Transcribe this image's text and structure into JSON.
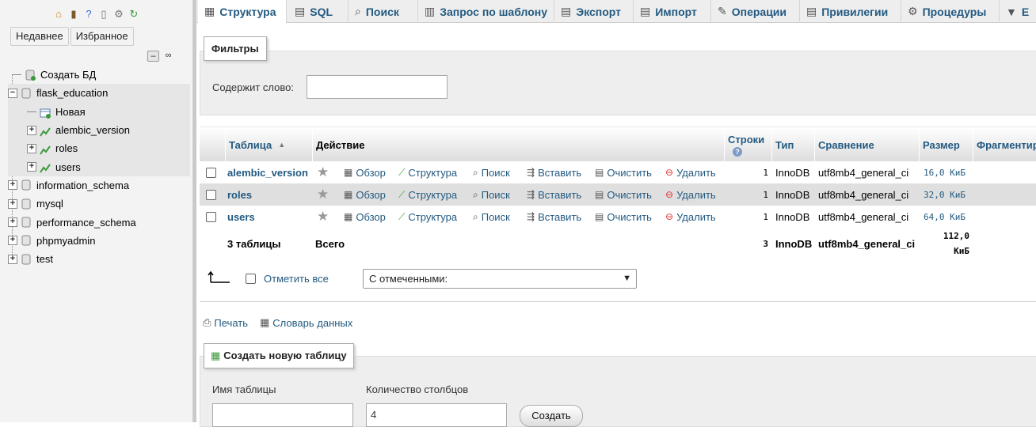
{
  "sidebar": {
    "recent_tabs": [
      "Недавнее",
      "Избранное"
    ],
    "tree": {
      "create_db": "Создать БД",
      "databases": [
        {
          "name": "flask_education",
          "expanded": true,
          "children": [
            {
              "name": "Новая"
            },
            {
              "name": "alembic_version"
            },
            {
              "name": "roles"
            },
            {
              "name": "users"
            }
          ]
        },
        {
          "name": "information_schema"
        },
        {
          "name": "mysql"
        },
        {
          "name": "performance_schema"
        },
        {
          "name": "phpmyadmin"
        },
        {
          "name": "test"
        }
      ]
    }
  },
  "tabs": [
    {
      "label": "Структура",
      "icon": "structure-icon",
      "active": true
    },
    {
      "label": "SQL",
      "icon": "sql-icon"
    },
    {
      "label": "Поиск",
      "icon": "search-icon"
    },
    {
      "label": "Запрос по шаблону",
      "icon": "query-icon"
    },
    {
      "label": "Экспорт",
      "icon": "export-icon"
    },
    {
      "label": "Импорт",
      "icon": "import-icon"
    },
    {
      "label": "Операции",
      "icon": "wrench-icon"
    },
    {
      "label": "Привилегии",
      "icon": "privileges-icon"
    },
    {
      "label": "Процедуры",
      "icon": "routines-icon"
    },
    {
      "label": "E",
      "icon": "more-icon"
    }
  ],
  "filters": {
    "legend": "Фильтры",
    "contains_label": "Содержит слово:",
    "value": ""
  },
  "table": {
    "headers": {
      "table": "Таблица",
      "action": "Действие",
      "rows": "Строки",
      "type": "Тип",
      "collation": "Сравнение",
      "size": "Размер",
      "overhead": "Фрагментир"
    },
    "actions": {
      "browse": "Обзор",
      "structure": "Структура",
      "search": "Поиск",
      "insert": "Вставить",
      "empty": "Очистить",
      "drop": "Удалить"
    },
    "rows": [
      {
        "name": "alembic_version",
        "rows": "1",
        "type": "InnoDB",
        "collation": "utf8mb4_general_ci",
        "size": "16,0 КиБ"
      },
      {
        "name": "roles",
        "rows": "1",
        "type": "InnoDB",
        "collation": "utf8mb4_general_ci",
        "size": "32,0 КиБ"
      },
      {
        "name": "users",
        "rows": "1",
        "type": "InnoDB",
        "collation": "utf8mb4_general_ci",
        "size": "64,0 КиБ"
      }
    ],
    "footer": {
      "count": "3 таблицы",
      "total": "Всего",
      "rows": "3",
      "type": "InnoDB",
      "collation": "utf8mb4_general_ci",
      "size_line1": "112,0",
      "size_line2": "КиБ"
    }
  },
  "bulk": {
    "check_all": "Отметить все",
    "with_selected": "С отмеченными:"
  },
  "links": {
    "print": "Печать",
    "dictionary": "Словарь данных"
  },
  "create_table": {
    "legend": "Создать новую таблицу",
    "name_label": "Имя таблицы",
    "columns_label": "Количество столбцов",
    "columns_value": "4",
    "button": "Создать"
  }
}
